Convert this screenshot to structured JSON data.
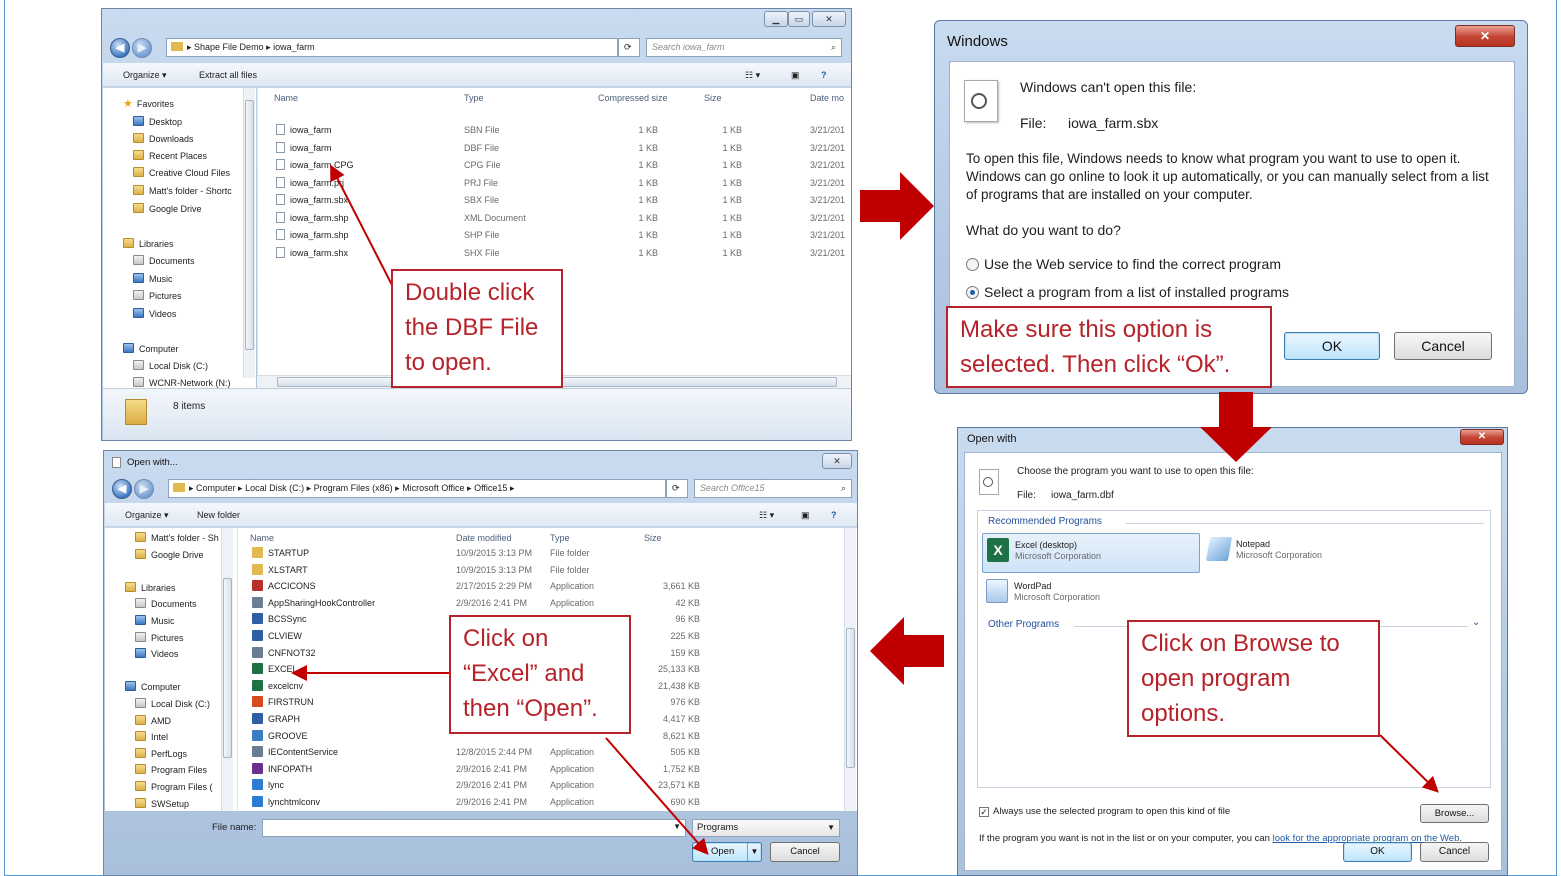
{
  "explorer": {
    "breadcrumb": [
      "Shape File Demo",
      "iowa_farm"
    ],
    "search_placeholder": "Search iowa_farm",
    "toolbar": {
      "organize": "Organize ▾",
      "extract": "Extract all files"
    },
    "nav": {
      "favorites": "Favorites",
      "favorite_items": [
        "Desktop",
        "Downloads",
        "Recent Places",
        "Creative Cloud Files",
        "Matt's folder - Shortc",
        "Google Drive"
      ],
      "libraries": "Libraries",
      "library_items": [
        "Documents",
        "Music",
        "Pictures",
        "Videos"
      ],
      "computer": "Computer",
      "computer_items": [
        "Local Disk (C:)",
        "WCNR-Network (N:)"
      ]
    },
    "columns": [
      "Name",
      "Type",
      "Compressed size",
      "Size",
      "Date mo"
    ],
    "files": [
      {
        "name": "iowa_farm",
        "type": "SBN File",
        "csize": "1 KB",
        "size": "1 KB",
        "date": "3/21/201"
      },
      {
        "name": "iowa_farm",
        "type": "DBF File",
        "csize": "1 KB",
        "size": "1 KB",
        "date": "3/21/201"
      },
      {
        "name": "iowa_farm.CPG",
        "type": "CPG File",
        "csize": "1 KB",
        "size": "1 KB",
        "date": "3/21/201"
      },
      {
        "name": "iowa_farm.prj",
        "type": "PRJ File",
        "csize": "1 KB",
        "size": "1 KB",
        "date": "3/21/201"
      },
      {
        "name": "iowa_farm.sbx",
        "type": "SBX File",
        "csize": "1 KB",
        "size": "1 KB",
        "date": "3/21/201"
      },
      {
        "name": "iowa_farm.shp",
        "type": "XML Document",
        "csize": "1 KB",
        "size": "1 KB",
        "date": "3/21/201"
      },
      {
        "name": "iowa_farm.shp",
        "type": "SHP File",
        "csize": "1 KB",
        "size": "1 KB",
        "date": "3/21/201"
      },
      {
        "name": "iowa_farm.shx",
        "type": "SHX File",
        "csize": "1 KB",
        "size": "1 KB",
        "date": "3/21/201"
      }
    ],
    "status": "8 items"
  },
  "windows_dialog": {
    "title": "Windows",
    "heading": "Windows can't open this file:",
    "file_label": "File:",
    "file_name": "iowa_farm.sbx",
    "description": "To open this file, Windows needs to know what program you want to use to open it. Windows can go online to look it up automatically, or you can manually select from a list of programs that are installed on your computer.",
    "question": "What do you want to do?",
    "option_web": "Use the Web service to find the correct program",
    "option_list": "Select a program from a list of installed programs",
    "ok": "OK",
    "cancel": "Cancel"
  },
  "open_with": {
    "title": "Open with",
    "heading": "Choose the program you want to use to open this file:",
    "file_label": "File:",
    "file_name": "iowa_farm.dbf",
    "recommended": "Recommended Programs",
    "programs": [
      {
        "name": "Excel (desktop)",
        "publisher": "Microsoft Corporation"
      },
      {
        "name": "Notepad",
        "publisher": "Microsoft Corporation"
      },
      {
        "name": "WordPad",
        "publisher": "Microsoft Corporation"
      }
    ],
    "other": "Other Programs",
    "always_use": "Always use the selected program to open this kind of file",
    "browse": "Browse...",
    "note_prefix": "If the program you want is not in the list or on your computer, you can ",
    "note_link": "look for the appropriate program on the Web",
    "note_suffix": ".",
    "ok": "OK",
    "cancel": "Cancel"
  },
  "file_dialog": {
    "title": "Open with...",
    "breadcrumb": [
      "Computer",
      "Local Disk (C:)",
      "Program Files (x86)",
      "Microsoft Office",
      "Office15"
    ],
    "search_placeholder": "Search Office15",
    "toolbar": {
      "organize": "Organize ▾",
      "new_folder": "New folder"
    },
    "nav": [
      "Matt's folder - Sh",
      "Google Drive",
      "",
      "Libraries",
      "Documents",
      "Music",
      "Pictures",
      "Videos",
      "",
      "Computer",
      "Local Disk (C:)",
      "AMD",
      "Intel",
      "PerfLogs",
      "Program Files",
      "Program Files (",
      "SWSetup"
    ],
    "columns": [
      "Name",
      "Date modified",
      "Type",
      "Size"
    ],
    "files": [
      {
        "name": "STARTUP",
        "date": "10/9/2015 3:13 PM",
        "type": "File folder",
        "size": ""
      },
      {
        "name": "XLSTART",
        "date": "10/9/2015 3:13 PM",
        "type": "File folder",
        "size": ""
      },
      {
        "name": "ACCICONS",
        "date": "2/17/2015 2:29 PM",
        "type": "Application",
        "size": "3,661 KB"
      },
      {
        "name": "AppSharingHookController",
        "date": "2/9/2016 2:41 PM",
        "type": "Application",
        "size": "42 KB"
      },
      {
        "name": "BCSSync",
        "date": "",
        "type": "",
        "size": "96 KB"
      },
      {
        "name": "CLVIEW",
        "date": "",
        "type": "",
        "size": "225 KB"
      },
      {
        "name": "CNFNOT32",
        "date": "",
        "type": "",
        "size": "159 KB"
      },
      {
        "name": "EXCEL",
        "date": "",
        "type": "",
        "size": "25,133 KB"
      },
      {
        "name": "excelcnv",
        "date": "",
        "type": "",
        "size": "21,438 KB"
      },
      {
        "name": "FIRSTRUN",
        "date": "",
        "type": "",
        "size": "976 KB"
      },
      {
        "name": "GRAPH",
        "date": "",
        "type": "",
        "size": "4,417 KB"
      },
      {
        "name": "GROOVE",
        "date": "",
        "type": "",
        "size": "8,621 KB"
      },
      {
        "name": "IEContentService",
        "date": "12/8/2015 2:44 PM",
        "type": "Application",
        "size": "505 KB"
      },
      {
        "name": "INFOPATH",
        "date": "2/9/2016 2:41 PM",
        "type": "Application",
        "size": "1,752 KB"
      },
      {
        "name": "lync",
        "date": "2/9/2016 2:41 PM",
        "type": "Application",
        "size": "23,571 KB"
      },
      {
        "name": "lynchtmlconv",
        "date": "2/9/2016 2:41 PM",
        "type": "Application",
        "size": "690 KB"
      }
    ],
    "filename_label": "File name:",
    "filetype": "Programs",
    "open": "Open",
    "cancel": "Cancel"
  },
  "callouts": {
    "dbf": "Double click the DBF File to open.",
    "option": "Make sure this option is selected. Then click “Ok”.",
    "browse": "Click on Browse to open program options.",
    "excel": "Click on “Excel” and then “Open”."
  },
  "colors": {
    "callout": "#b7232a",
    "arrow": "#c00000",
    "frame": "#5b9bd5"
  }
}
